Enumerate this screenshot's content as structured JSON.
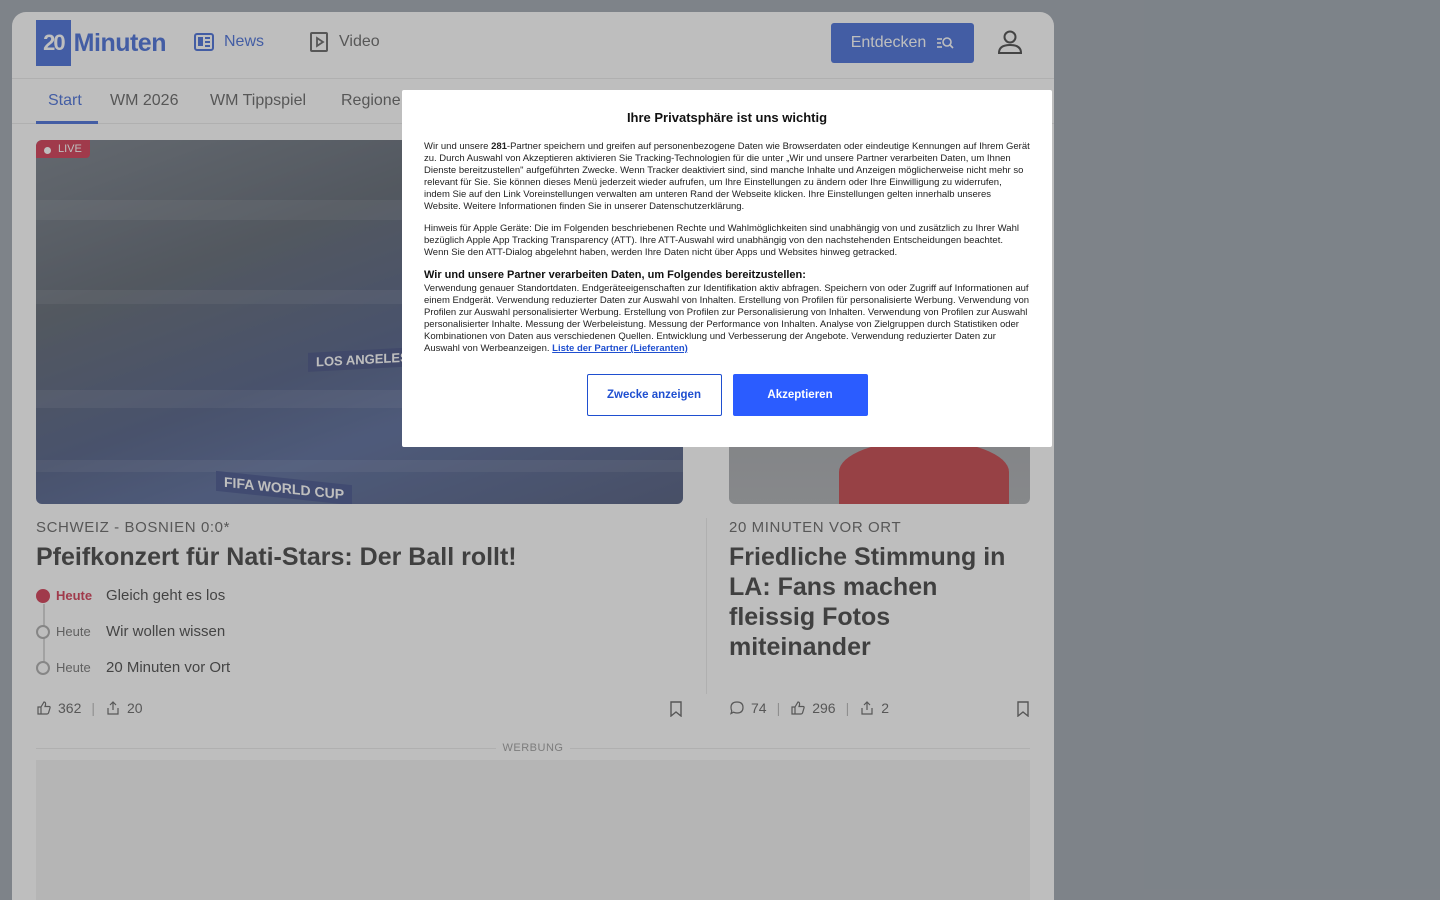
{
  "header": {
    "logo_mark": "20",
    "logo_text": "Minuten",
    "nav_news": "News",
    "nav_video": "Video",
    "discover_label": "Entdecken"
  },
  "tabs": [
    {
      "label": "Start"
    },
    {
      "label": "WM 2026"
    },
    {
      "label": "WM Tippspiel"
    },
    {
      "label": "Regione"
    }
  ],
  "main_story": {
    "live_badge": "LIVE",
    "image_banner_1": "LOS ANGELES",
    "image_banner_2": "FIFA WORLD CUP",
    "kicker": "SCHWEIZ - BOSNIEN 0:0*",
    "headline": "Pfeifkonzert für Nati-Stars: Der Ball rollt!",
    "ticker": [
      {
        "time": "Heute",
        "text": "Gleich geht es los",
        "live": true
      },
      {
        "time": "Heute",
        "text": "Wir wollen wissen",
        "live": false
      },
      {
        "time": "Heute",
        "text": "20 Minuten vor Ort",
        "live": false
      }
    ],
    "likes": "362",
    "shares": "20"
  },
  "side_story": {
    "kicker": "20 MINUTEN VOR ORT",
    "headline": "Friedliche Stimmung in LA: Fans machen fleissig Fotos miteinander",
    "comments": "74",
    "likes": "296",
    "shares": "2"
  },
  "ad": {
    "label": "WERBUNG"
  },
  "consent": {
    "title": "Ihre Privatsphäre ist uns wichtig",
    "para1_pre": "Wir und unsere ",
    "para1_count": "281",
    "para1_post": "-Partner speichern und greifen auf personenbezogene Daten wie Browserdaten oder eindeutige Kennungen auf Ihrem Gerät zu. Durch Auswahl von Akzeptieren aktivieren Sie Tracking-Technologien für die unter „Wir und unsere Partner verarbeiten Daten, um Ihnen Dienste bereitzustellen\" aufgeführten Zwecke. Wenn Tracker deaktiviert sind, sind manche Inhalte und Anzeigen möglicherweise nicht mehr so relevant für Sie. Sie können dieses Menü jederzeit wieder aufrufen, um Ihre Einstellungen zu ändern oder Ihre Einwilligung zu widerrufen, indem Sie auf den Link Voreinstellungen verwalten am unteren Rand der Webseite klicken. Ihre Einstellungen gelten innerhalb unseres Website. Weitere Informationen finden Sie in unserer Datenschutzerklärung.",
    "para2": "Hinweis für Apple Geräte: Die im Folgenden beschriebenen Rechte und Wahlmöglichkeiten sind unabhängig von und zusätzlich zu Ihrer Wahl bezüglich Apple App Tracking Transparency (ATT). Ihre ATT-Auswahl wird unabhängig von den nachstehenden Entscheidungen beachtet. Wenn Sie den ATT-Dialog abgelehnt haben, werden Ihre Daten nicht über Apps und Websites hinweg getracked.",
    "subheading": "Wir und unsere Partner verarbeiten Daten, um Folgendes bereitzustellen:",
    "para3": "Verwendung genauer Standortdaten. Endgeräteeigenschaften zur Identifikation aktiv abfragen. Speichern von oder Zugriff auf Informationen auf einem Endgerät. Verwendung reduzierter Daten zur Auswahl von Inhalten. Erstellung von Profilen für personalisierte Werbung. Verwendung von Profilen zur Auswahl personalisierter Werbung. Erstellung von Profilen zur Personalisierung von Inhalten. Verwendung von Profilen zur Auswahl personalisierter Inhalte. Messung der Werbeleistung. Messung der Performance von Inhalten. Analyse von Zielgruppen durch Statistiken oder Kombinationen von Daten aus verschiedenen Quellen. Entwicklung und Verbesserung der Angebote. Verwendung reduzierter Daten zur Auswahl von Werbeanzeigen. ",
    "partner_link": "Liste der Partner (Lieferanten)",
    "btn_purposes": "Zwecke anzeigen",
    "btn_accept": "Akzeptieren"
  },
  "colors": {
    "brand": "#1f4fd0",
    "live": "#c8102e",
    "accept": "#2b5cff"
  }
}
